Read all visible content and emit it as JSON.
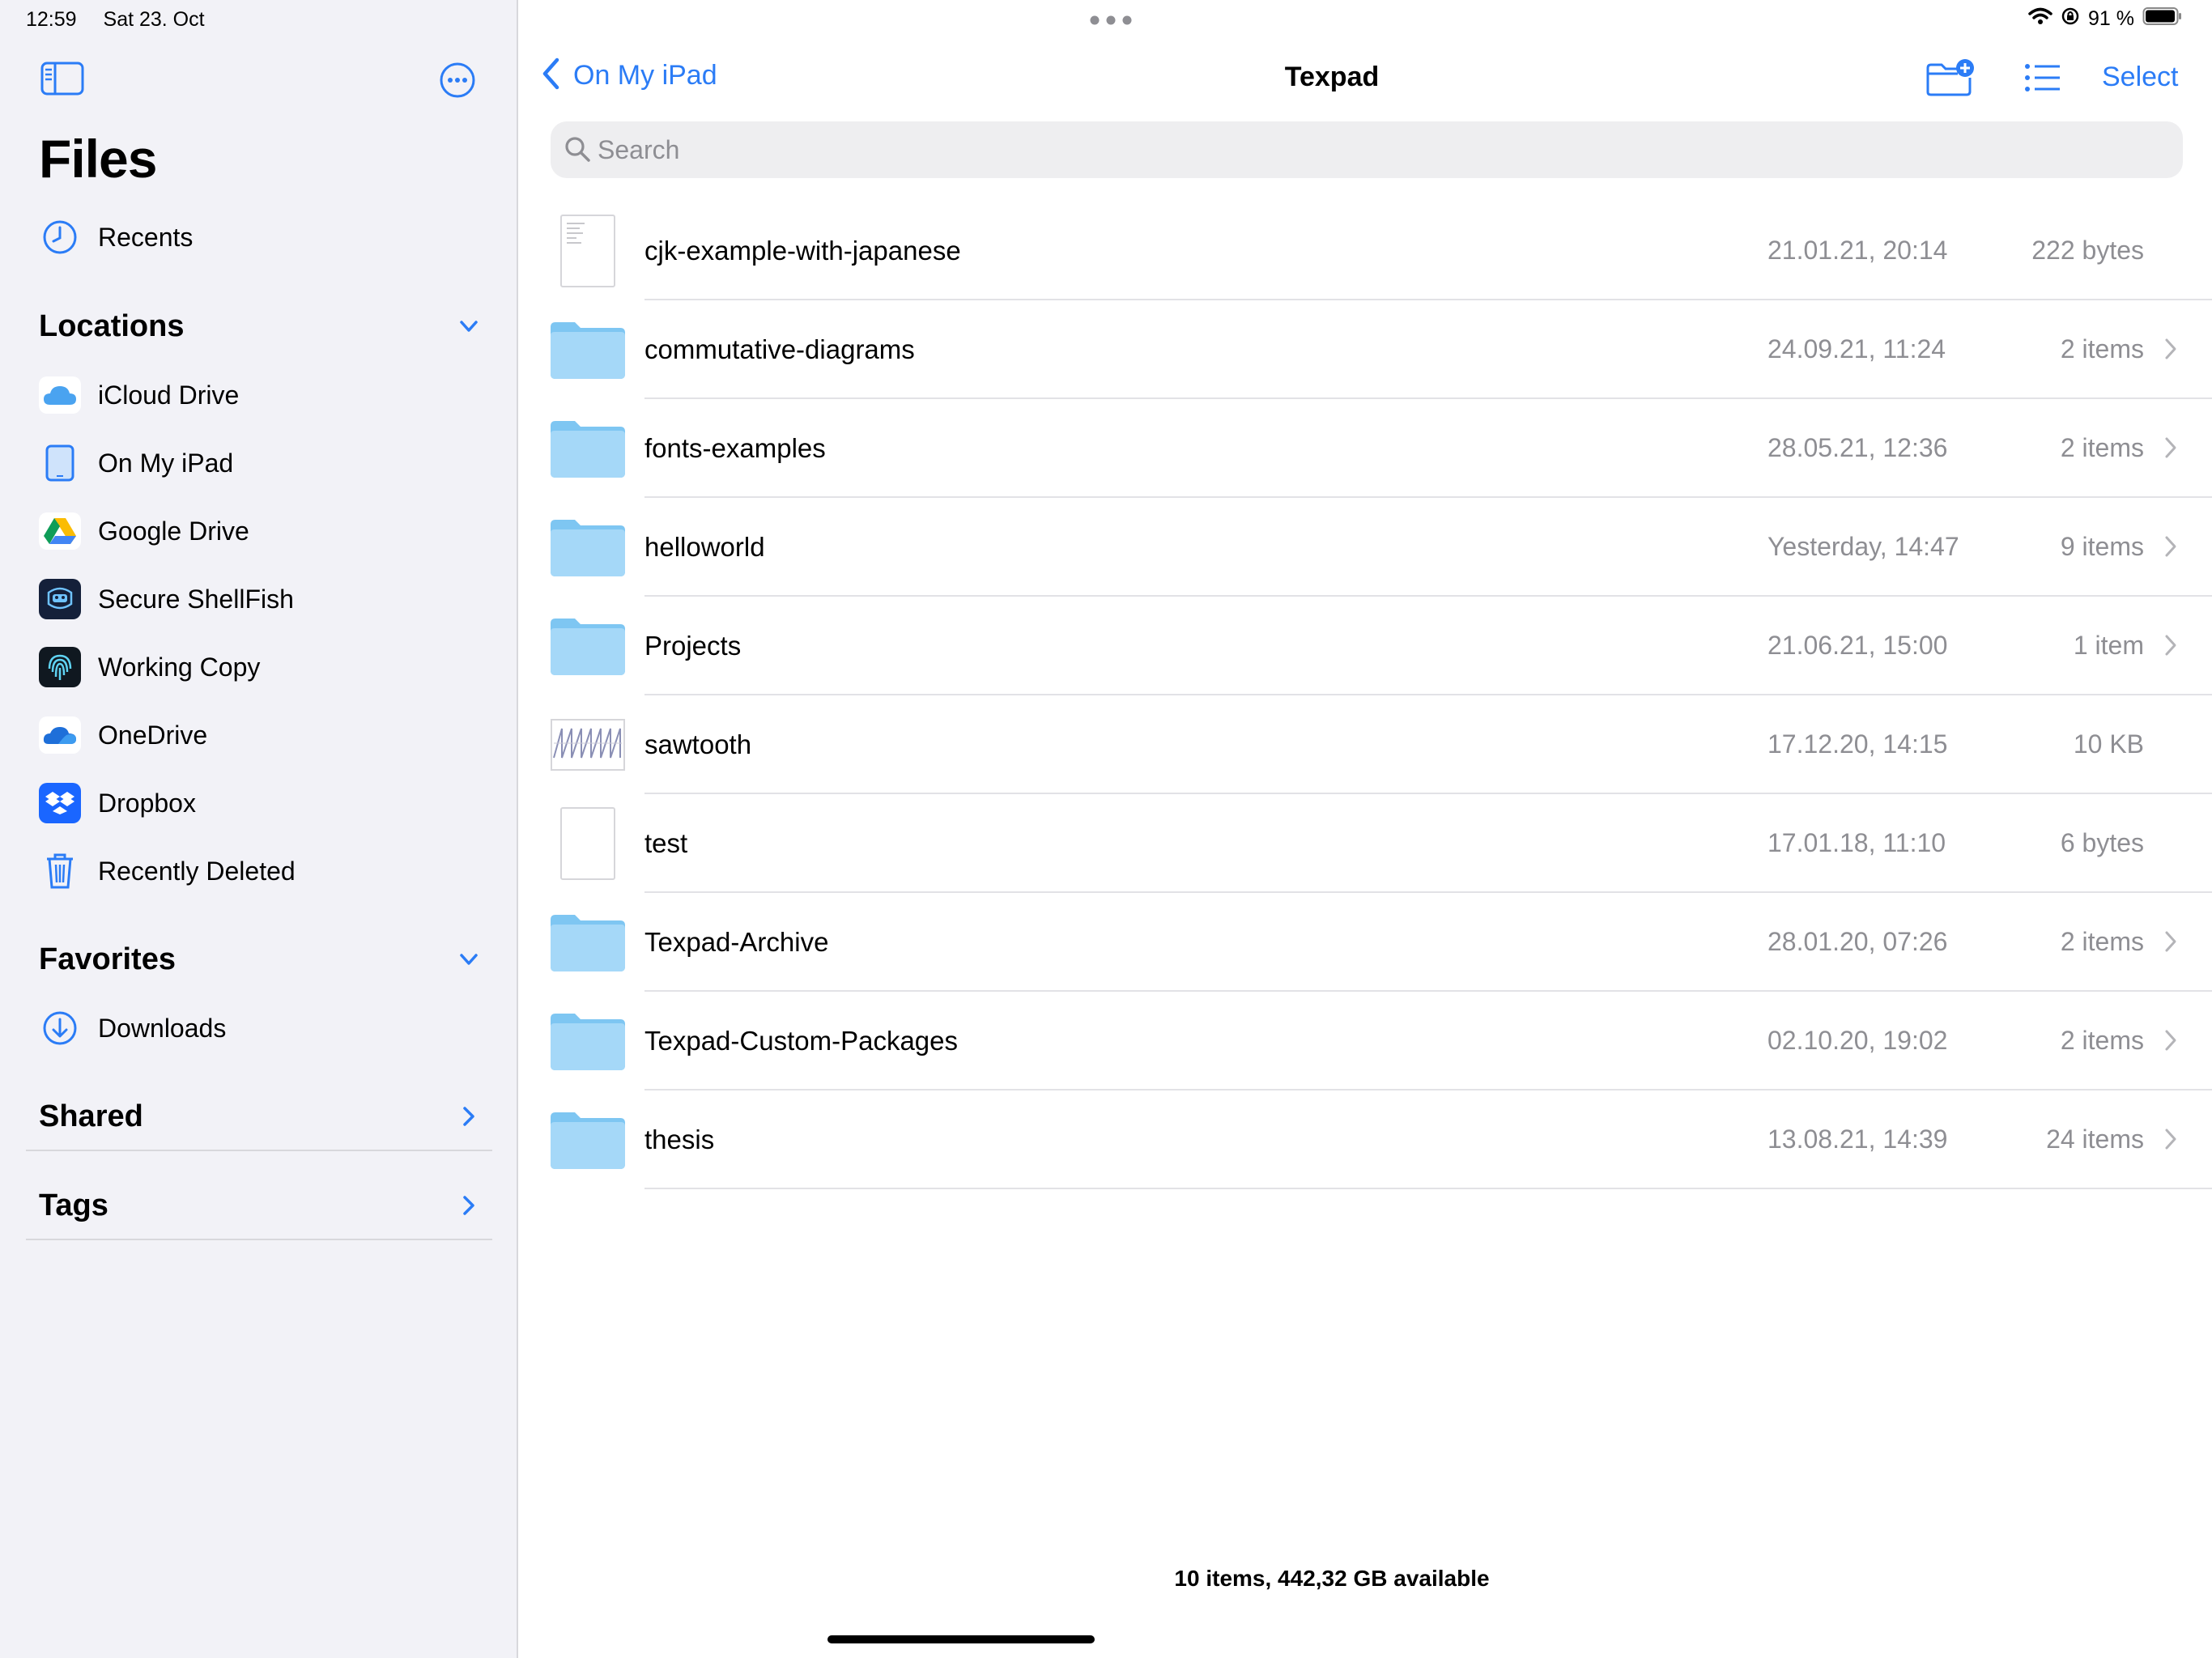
{
  "status": {
    "time": "12:59",
    "date": "Sat 23. Oct",
    "battery": "91 %"
  },
  "sidebar": {
    "title": "Files",
    "recents": "Recents",
    "locations": {
      "header": "Locations",
      "items": [
        {
          "label": "iCloud Drive",
          "icon": "icloud-icon"
        },
        {
          "label": "On My iPad",
          "icon": "ipad-icon"
        },
        {
          "label": "Google Drive",
          "icon": "google-drive-icon"
        },
        {
          "label": "Secure ShellFish",
          "icon": "shellfish-icon"
        },
        {
          "label": "Working Copy",
          "icon": "working-copy-icon"
        },
        {
          "label": "OneDrive",
          "icon": "onedrive-icon"
        },
        {
          "label": "Dropbox",
          "icon": "dropbox-icon"
        },
        {
          "label": "Recently Deleted",
          "icon": "trash-icon"
        }
      ]
    },
    "favorites": {
      "header": "Favorites",
      "items": [
        {
          "label": "Downloads",
          "icon": "downloads-icon"
        }
      ]
    },
    "shared": "Shared",
    "tags": "Tags"
  },
  "nav": {
    "back_label": "On My iPad",
    "title": "Texpad",
    "select_label": "Select"
  },
  "search": {
    "placeholder": "Search"
  },
  "files": [
    {
      "name": "cjk-example-with-japanese",
      "date": "21.01.21, 20:14",
      "size": "222 bytes",
      "kind": "document",
      "chevron": false
    },
    {
      "name": "commutative-diagrams",
      "date": "24.09.21, 11:24",
      "size": "2 items",
      "kind": "folder",
      "chevron": true
    },
    {
      "name": "fonts-examples",
      "date": "28.05.21, 12:36",
      "size": "2 items",
      "kind": "folder",
      "chevron": true
    },
    {
      "name": "helloworld",
      "date": "Yesterday, 14:47",
      "size": "9 items",
      "kind": "folder",
      "chevron": true
    },
    {
      "name": "Projects",
      "date": "21.06.21, 15:00",
      "size": "1 item",
      "kind": "folder",
      "chevron": true
    },
    {
      "name": "sawtooth",
      "date": "17.12.20, 14:15",
      "size": "10 KB",
      "kind": "image",
      "chevron": false
    },
    {
      "name": "test",
      "date": "17.01.18, 11:10",
      "size": "6 bytes",
      "kind": "blank",
      "chevron": false
    },
    {
      "name": "Texpad-Archive",
      "date": "28.01.20, 07:26",
      "size": "2 items",
      "kind": "folder",
      "chevron": true
    },
    {
      "name": "Texpad-Custom-Packages",
      "date": "02.10.20, 19:02",
      "size": "2 items",
      "kind": "folder",
      "chevron": true
    },
    {
      "name": "thesis",
      "date": "13.08.21, 14:39",
      "size": "24 items",
      "kind": "folder",
      "chevron": true
    }
  ],
  "footer": {
    "summary": "10 items, 442,32 GB available"
  },
  "colors": {
    "accent": "#2b7cf6",
    "folder": "#8ccdf5",
    "sidebar_bg": "#f2f2f7",
    "secondary_text": "#8e8e93"
  }
}
